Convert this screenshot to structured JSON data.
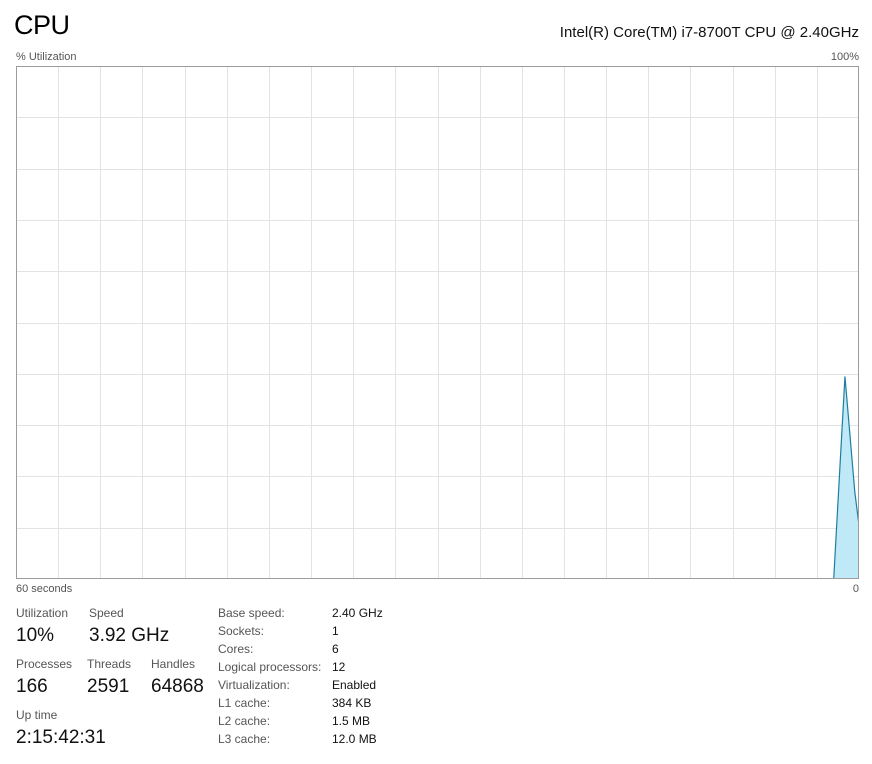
{
  "header": {
    "title": "CPU",
    "cpu_name": "Intel(R) Core(TM) i7-8700T CPU @ 2.40GHz",
    "y_axis_label": "% Utilization",
    "y_axis_max": "100%",
    "x_axis_left": "60 seconds",
    "x_axis_right": "0"
  },
  "colors": {
    "graph_border": "#9c9c9c",
    "grid": "#e3e3e3",
    "fill": "#bfe9f7",
    "line": "#1e7ea0"
  },
  "chart_data": {
    "type": "area",
    "xlabel": "60 seconds",
    "ylabel": "% Utilization",
    "ylim": [
      0,
      100
    ],
    "xlim": [
      60,
      0
    ],
    "grid": true,
    "series": [
      {
        "x": [
          1.8,
          1.0,
          0.3,
          0.0
        ],
        "values": [
          0,
          39.5,
          17,
          10.5
        ]
      }
    ]
  },
  "stats": {
    "utilization": {
      "label": "Utilization",
      "value": "10%"
    },
    "speed": {
      "label": "Speed",
      "value": "3.92 GHz"
    },
    "processes": {
      "label": "Processes",
      "value": "166"
    },
    "threads": {
      "label": "Threads",
      "value": "2591"
    },
    "handles": {
      "label": "Handles",
      "value": "64868"
    },
    "uptime": {
      "label": "Up time",
      "value": "2:15:42:31"
    }
  },
  "details": [
    {
      "label": "Base speed:",
      "value": "2.40 GHz"
    },
    {
      "label": "Sockets:",
      "value": "1"
    },
    {
      "label": "Cores:",
      "value": "6"
    },
    {
      "label": "Logical processors:",
      "value": "12"
    },
    {
      "label": "Virtualization:",
      "value": "Enabled"
    },
    {
      "label": "L1 cache:",
      "value": "384 KB"
    },
    {
      "label": "L2 cache:",
      "value": "1.5 MB"
    },
    {
      "label": "L3 cache:",
      "value": "12.0 MB"
    }
  ]
}
